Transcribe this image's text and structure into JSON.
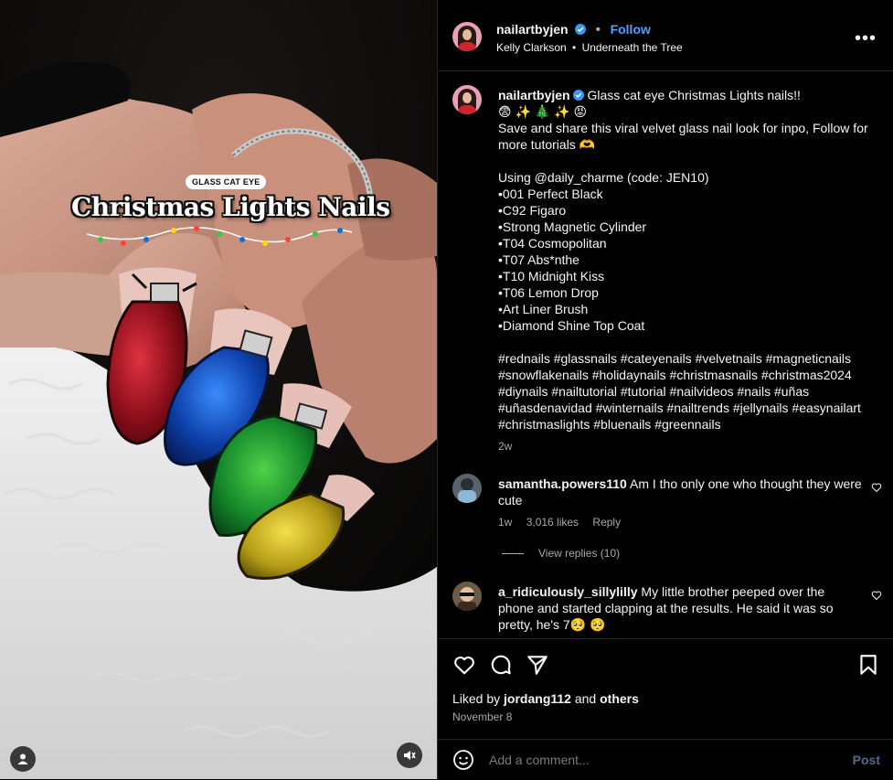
{
  "media": {
    "overlay_label": "GLASS CAT EYE",
    "overlay_title": "Christmas Lights Nails",
    "icons": [
      "user-tag-icon",
      "mute-icon"
    ]
  },
  "header": {
    "username": "nailartbyjen",
    "follow_label": "Follow",
    "audio_artist": "Kelly Clarkson",
    "audio_track": "Underneath the Tree"
  },
  "caption": {
    "username": "nailartbyjen",
    "title": "Glass cat eye Christmas Lights nails!!",
    "emoji_line": "😨 ✨ 🎄 ✨ 😡",
    "line1": "Save and share this viral velvet glass nail look for inpo, Follow for more tutorials 🫶",
    "using": "Using @daily_charme (code: JEN10)",
    "items": [
      "•001 Perfect Black",
      "•C92 Figaro",
      "•Strong Magnetic Cylinder",
      "•T04 Cosmopolitan",
      "•T07 Abs*nthe",
      "•T10 Midnight Kiss",
      "•T06 Lemon Drop",
      "•Art Liner Brush",
      "•Diamond Shine Top Coat"
    ],
    "hashtags": "#rednails #glassnails #cateyenails #velvetnails #magneticnails #snowflakenails #holidaynails #christmasnails #christmas2024 #diynails #nailtutorial #tutorial #nailvideos #nails #uñas #uñasdenavidad #winternails #nailtrends #jellynails #easynailart #christmaslights #bluenails #greennails",
    "age": "2w"
  },
  "comments": [
    {
      "username": "samantha.powers110",
      "text": "Am I tho only one who thought they were cute",
      "age": "1w",
      "likes": "3,016 likes",
      "reply_label": "Reply",
      "view_replies": "View replies (10)"
    },
    {
      "username": "a_ridiculously_sillylilly",
      "text": "My little brother peeped over the phone and started clapping at the results. He said it was so pretty, he's 7🥺 🥺"
    }
  ],
  "footer": {
    "liked_by_prefix": "Liked by",
    "liked_by_user": "jordang112",
    "liked_by_and": "and",
    "liked_by_others": "others",
    "date": "November 8",
    "comment_placeholder": "Add a comment...",
    "post_label": "Post"
  },
  "colors": {
    "accent": "#4aa3ff",
    "background": "#000000",
    "muted": "#a8a8a8"
  }
}
